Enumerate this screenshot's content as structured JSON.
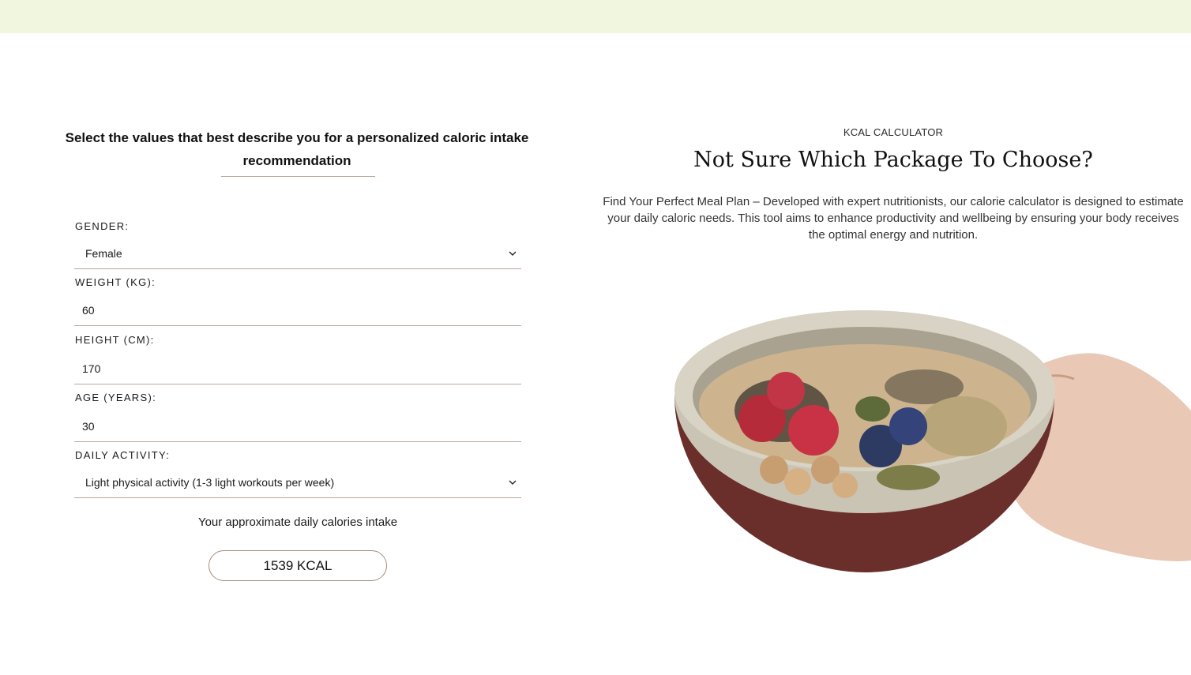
{
  "form": {
    "intro": "Select the values that best describe you for a personalized caloric intake recommendation",
    "gender": {
      "label": "GENDER:",
      "value": "Female"
    },
    "weight": {
      "label": "WEIGHT (KG):",
      "value": "60"
    },
    "height": {
      "label": "HEIGHT (CM):",
      "value": "170"
    },
    "age": {
      "label": "AGE (YEARS):",
      "value": "30"
    },
    "activity": {
      "label": "DAILY ACTIVITY:",
      "value": "Light physical activity (1-3 light workouts per week)"
    },
    "result_label": "Your approximate daily calories intake",
    "result_value": "1539 KCAL"
  },
  "info": {
    "eyebrow": "KCAL CALCULATOR",
    "headline": "Not Sure Which Package To Choose?",
    "description": "Find Your Perfect Meal Plan – Developed with expert nutritionists, our calorie calculator is designed to estimate your daily caloric needs. This tool aims to enhance productivity and wellbeing by ensuring your body receives the optimal energy and nutrition."
  },
  "colors": {
    "topbar": "#f1f7df",
    "rule": "#b9a79a",
    "button_border": "#a48e7f"
  },
  "icons": {
    "dropdown": "chevron-down-icon"
  }
}
